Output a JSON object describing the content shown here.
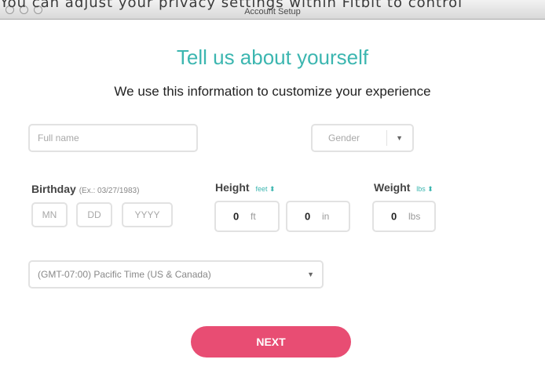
{
  "overlay_caption": "You can adjust your privacy settings within Fitbit to control",
  "window": {
    "title": "Account Setup"
  },
  "heading": "Tell us about yourself",
  "subheading": "We use this information to customize your experience",
  "form": {
    "full_name_placeholder": "Full name",
    "gender_selected": "Gender",
    "birthday": {
      "label": "Birthday",
      "hint": "(Ex.: 03/27/1983)",
      "mm_placeholder": "MN",
      "dd_placeholder": "DD",
      "yyyy_placeholder": "YYYY"
    },
    "height": {
      "label": "Height",
      "unit_selector": "feet ⬍",
      "feet_value": "0",
      "feet_unit": "ft",
      "inches_value": "0",
      "inches_unit": "in"
    },
    "weight": {
      "label": "Weight",
      "unit_selector": "lbs ⬍",
      "value": "0",
      "unit": "lbs"
    },
    "timezone_selected": "(GMT-07:00) Pacific Time (US & Canada)"
  },
  "next_button": "NEXT",
  "colors": {
    "accent_teal": "#3cb6b0",
    "button_pink": "#e84d73"
  }
}
